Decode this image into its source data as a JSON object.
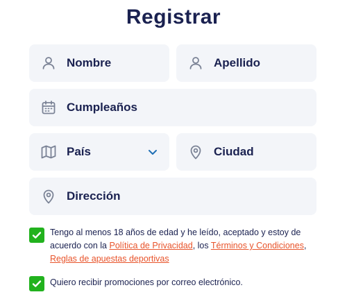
{
  "title": "Registrar",
  "fields": {
    "nombre": "Nombre",
    "apellido": "Apellido",
    "cumpleanos": "Cumpleaños",
    "pais": "País",
    "ciudad": "Ciudad",
    "direccion": "Dirección"
  },
  "icons": {
    "nombre": "user-icon",
    "apellido": "user-icon",
    "cumpleanos": "calendar-icon",
    "pais": "map-icon",
    "pais_dropdown": "chevron-down-icon",
    "ciudad": "location-pin-icon",
    "direccion": "location-pin-icon"
  },
  "consent": {
    "age_text_1": "Tengo al menos 18 años de edad y he leído, aceptado y estoy de acuerdo con la ",
    "privacy_link": "Política de Privacidad",
    "sep_1": ", los ",
    "terms_link": "Términos y Condiciones",
    "sep_2": ",",
    "betting_link": "Reglas de apuestas deportivas",
    "promo_text": "Quiero recibir promociones por correo electrónico.",
    "age_checked": true,
    "promo_checked": true
  },
  "colors": {
    "title": "#1a2150",
    "field_bg": "#f3f5f9",
    "icon": "#7b8396",
    "chevron": "#1f6fb5",
    "checkbox": "#22b21e",
    "link": "#e8532a"
  }
}
